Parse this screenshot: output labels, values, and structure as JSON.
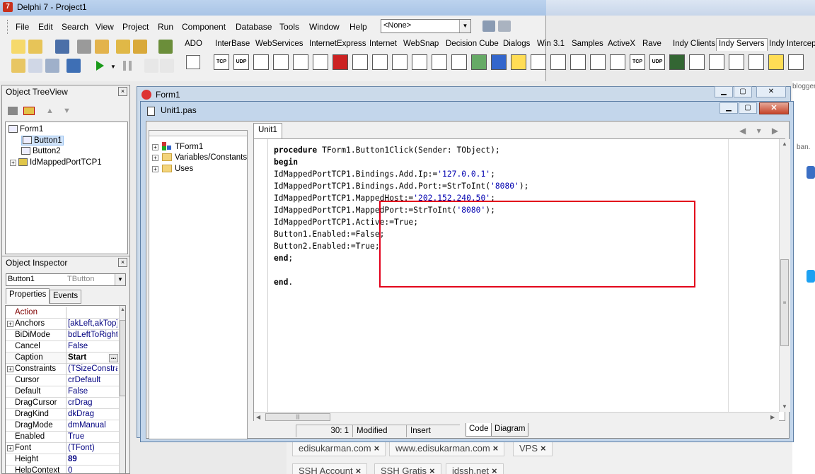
{
  "window": {
    "title": "Delphi 7 - Project1"
  },
  "menu": [
    "File",
    "Edit",
    "Search",
    "View",
    "Project",
    "Run",
    "Component",
    "Database",
    "Tools",
    "Window",
    "Help"
  ],
  "desktop_combo": "<None>",
  "palette_tabs": [
    "ADO",
    "InterBase",
    "WebServices",
    "InternetExpress",
    "Internet",
    "WebSnap",
    "Decision Cube",
    "Dialogs",
    "Win 3.1",
    "Samples",
    "ActiveX",
    "Rave",
    "Indy Clients",
    "Indy Servers",
    "Indy Intercept"
  ],
  "palette_active": "Indy Servers",
  "palette_icons": [
    "TCP",
    "UDP"
  ],
  "tree_view": {
    "title": "Object TreeView",
    "nodes": [
      "Form1",
      "Button1",
      "Button2",
      "IdMappedPortTCP1"
    ]
  },
  "inspector": {
    "title": "Object Inspector",
    "selected_object": "Button1",
    "selected_type": "TButton",
    "tabs": [
      "Properties",
      "Events"
    ],
    "rows": [
      {
        "name": "Action",
        "value": ""
      },
      {
        "name": "Anchors",
        "value": "[akLeft,akTop]"
      },
      {
        "name": "BiDiMode",
        "value": "bdLeftToRight"
      },
      {
        "name": "Cancel",
        "value": "False"
      },
      {
        "name": "Caption",
        "value": "Start"
      },
      {
        "name": "Constraints",
        "value": "(TSizeConstraints)"
      },
      {
        "name": "Cursor",
        "value": "crDefault"
      },
      {
        "name": "Default",
        "value": "False"
      },
      {
        "name": "DragCursor",
        "value": "crDrag"
      },
      {
        "name": "DragKind",
        "value": "dkDrag"
      },
      {
        "name": "DragMode",
        "value": "dmManual"
      },
      {
        "name": "Enabled",
        "value": "True"
      },
      {
        "name": "Font",
        "value": "(TFont)"
      },
      {
        "name": "Height",
        "value": "89"
      },
      {
        "name": "HelpContext",
        "value": "0"
      }
    ]
  },
  "form": {
    "title": "Form1"
  },
  "editor": {
    "title": "Unit1.pas",
    "tab": "Unit1",
    "explorer": [
      "TForm1",
      "Variables/Constants",
      "Uses"
    ],
    "code": {
      "l1_kw": "procedure",
      "l1_rest": " TForm1.Button1Click(Sender: TObject);",
      "l2_kw": "begin",
      "l3_a": "IdMappedPortTCP1.Bindings.Add.Ip:=",
      "l3_s": "'127.0.0.1'",
      "l3_b": ";",
      "l4_a": "IdMappedPortTCP1.Bindings.Add.Port:=StrToInt(",
      "l4_s": "'8080'",
      "l4_b": ");",
      "l5_a": "IdMappedPortTCP1.MappedHost:=",
      "l5_s": "'202.152.240.50'",
      "l5_b": ";",
      "l6_a": "IdMappedPortTCP1.MappedPort:=StrToInt(",
      "l6_s": "'8080'",
      "l6_b": ");",
      "l7": "IdMappedPortTCP1.Active:=True;",
      "l8": "Button1.Enabled:=False;",
      "l9": "Button2.Enabled:=True;",
      "l10_kw": "end",
      "l10_b": ";",
      "l12_kw": "end",
      "l12_b": "."
    },
    "status": {
      "position": "30:   1",
      "state": "Modified",
      "mode": "Insert",
      "tab_code": "Code",
      "tab_diagram": "Diagram"
    }
  },
  "background": {
    "chips": [
      "edisukarman.com",
      "www.edisukarman.com",
      "VPS",
      "SSH Account",
      "SSH Gratis",
      "idssh.net"
    ],
    "right_texts": [
      "blogger",
      "ban."
    ]
  },
  "colors": {
    "highlight_box": "#e3001b",
    "string_literal": "#0000b0",
    "titlebar": "#bcd3ee",
    "close_button": "#c5442a"
  }
}
